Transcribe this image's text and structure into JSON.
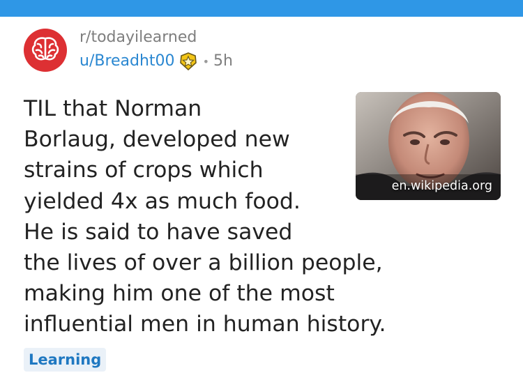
{
  "post": {
    "subreddit": "r/todayilearned",
    "username": "u/Breadht00",
    "age": "5h",
    "title_lines": [
      "TIL that Norman",
      "Borlaug, developed new",
      "strains of crops which",
      "yielded 4x as much food.",
      "He is said to have saved",
      "the lives of over a billion people,",
      "making him one of the most",
      "influential men in human history."
    ],
    "thumbnail": {
      "domain": "en.wikipedia.org"
    },
    "flair": "Learning"
  },
  "icons": {
    "subreddit_avatar": "brain-icon",
    "user_badge": "star-badge-icon"
  },
  "colors": {
    "top_bar": "#2f97e6",
    "avatar_bg": "#dd3033",
    "username": "#2a87d1",
    "flair_text": "#1f78c1",
    "flair_bg": "#eaf1f8"
  }
}
